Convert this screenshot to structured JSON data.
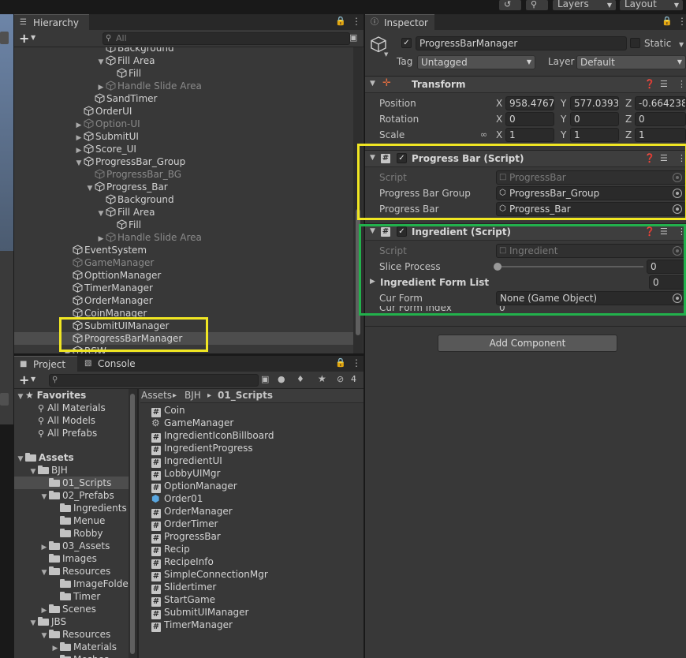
{
  "topbar": {
    "history_icon": "history-icon",
    "search_icon": "search-icon",
    "layers_label": "Layers",
    "layout_label": "Layout"
  },
  "hierarchy": {
    "tab_label": "Hierarchy",
    "search_placeholder": "All",
    "rows": [
      {
        "label": "Background",
        "dim": false
      },
      {
        "label": "Fill Area",
        "dim": false
      },
      {
        "label": "Fill",
        "dim": false
      },
      {
        "label": "Handle Slide Area",
        "dim": true
      },
      {
        "label": "SandTimer",
        "dim": false
      },
      {
        "label": "OrderUI",
        "dim": false
      },
      {
        "label": "Option-UI",
        "dim": true
      },
      {
        "label": "SubmitUI",
        "dim": false
      },
      {
        "label": "Score_UI",
        "dim": false
      },
      {
        "label": "ProgressBar_Group",
        "dim": false
      },
      {
        "label": "ProgressBar_BG",
        "dim": true
      },
      {
        "label": "Progress_Bar",
        "dim": false
      },
      {
        "label": "Background",
        "dim": false
      },
      {
        "label": "Fill Area",
        "dim": false
      },
      {
        "label": "Fill",
        "dim": false
      },
      {
        "label": "Handle Slide Area",
        "dim": true
      },
      {
        "label": "EventSystem",
        "dim": false
      },
      {
        "label": "GameManager",
        "dim": true
      },
      {
        "label": "OpttionManager",
        "dim": false
      },
      {
        "label": "TimerManager",
        "dim": false
      },
      {
        "label": "OrderManager",
        "dim": false
      },
      {
        "label": "CoinManager",
        "dim": false
      },
      {
        "label": "SubmitUIManager",
        "dim": false
      },
      {
        "label": "ProgressBarManager",
        "dim": false
      },
      {
        "label": "RSW",
        "dim": false
      }
    ]
  },
  "project": {
    "tab_project": "Project",
    "tab_console": "Console",
    "hidden_count": "4",
    "favorites": {
      "label": "Favorites",
      "items": [
        "All Materials",
        "All Models",
        "All Prefabs"
      ]
    },
    "assets_label": "Assets",
    "tree": [
      "BJH",
      "01_Scripts",
      "02_Prefabs",
      "Ingredients",
      "Menue",
      "Robby",
      "03_Assets",
      "Images",
      "Resources",
      "ImageFolde",
      "Timer",
      "Scenes",
      "JBS",
      "Resources",
      "Materials",
      "Meshes"
    ],
    "breadcrumb": [
      "Assets",
      "BJH",
      "01_Scripts"
    ],
    "files": [
      {
        "name": "Coin",
        "icon": "script-icon"
      },
      {
        "name": "GameManager",
        "icon": "gear-icon"
      },
      {
        "name": "IngredientIconBillboard",
        "icon": "script-icon"
      },
      {
        "name": "IngredientProgress",
        "icon": "script-icon"
      },
      {
        "name": "IngredientUI",
        "icon": "script-icon"
      },
      {
        "name": "LobbyUIMgr",
        "icon": "script-icon"
      },
      {
        "name": "OptionManager",
        "icon": "script-icon"
      },
      {
        "name": "Order01",
        "icon": "prefab-cube-icon"
      },
      {
        "name": "OrderManager",
        "icon": "script-icon"
      },
      {
        "name": "OrderTimer",
        "icon": "script-icon"
      },
      {
        "name": "ProgressBar",
        "icon": "script-icon"
      },
      {
        "name": "Recip",
        "icon": "script-icon"
      },
      {
        "name": "RecipeInfo",
        "icon": "script-icon"
      },
      {
        "name": "SimpleConnectionMgr",
        "icon": "script-icon"
      },
      {
        "name": "Slidertimer",
        "icon": "script-icon"
      },
      {
        "name": "StartGame",
        "icon": "script-icon"
      },
      {
        "name": "SubmitUIManager",
        "icon": "script-icon"
      },
      {
        "name": "TimerManager",
        "icon": "script-icon"
      }
    ]
  },
  "inspector": {
    "tab_label": "Inspector",
    "object_name": "ProgressBarManager",
    "static_label": "Static",
    "tag_label": "Tag",
    "tag_value": "Untagged",
    "layer_label": "Layer",
    "layer_value": "Default",
    "transform": {
      "title": "Transform",
      "position_label": "Position",
      "rotation_label": "Rotation",
      "scale_label": "Scale",
      "axis_x": "X",
      "axis_y": "Y",
      "axis_z": "Z",
      "position": [
        "958.4767",
        "577.0393",
        "-0.664238"
      ],
      "rotation": [
        "0",
        "0",
        "0"
      ],
      "scale": [
        "1",
        "1",
        "1"
      ]
    },
    "progress_bar_script": {
      "title": "Progress Bar (Script)",
      "script_label": "Script",
      "script_value": "ProgressBar",
      "group_label": "Progress Bar Group",
      "group_value": "ProgressBar_Group",
      "bar_label": "Progress Bar",
      "bar_value": "Progress_Bar"
    },
    "ingredient_script": {
      "title": "Ingredient (Script)",
      "script_label": "Script",
      "script_value": "Ingredient",
      "slice_label": "Slice Process",
      "slice_value": "0",
      "slice_fraction": 0,
      "form_list_label": "Ingredient Form List",
      "form_list_value": "0",
      "cur_form_label": "Cur Form",
      "cur_form_value": "None (Game Object)",
      "cur_form_index_label": "Cur Form Index",
      "cur_form_index_value": "0"
    },
    "add_component_label": "Add Component"
  },
  "colors": {
    "highlight_yellow": "#f0e623",
    "highlight_green": "#22b14c",
    "panel_bg": "#383838"
  }
}
